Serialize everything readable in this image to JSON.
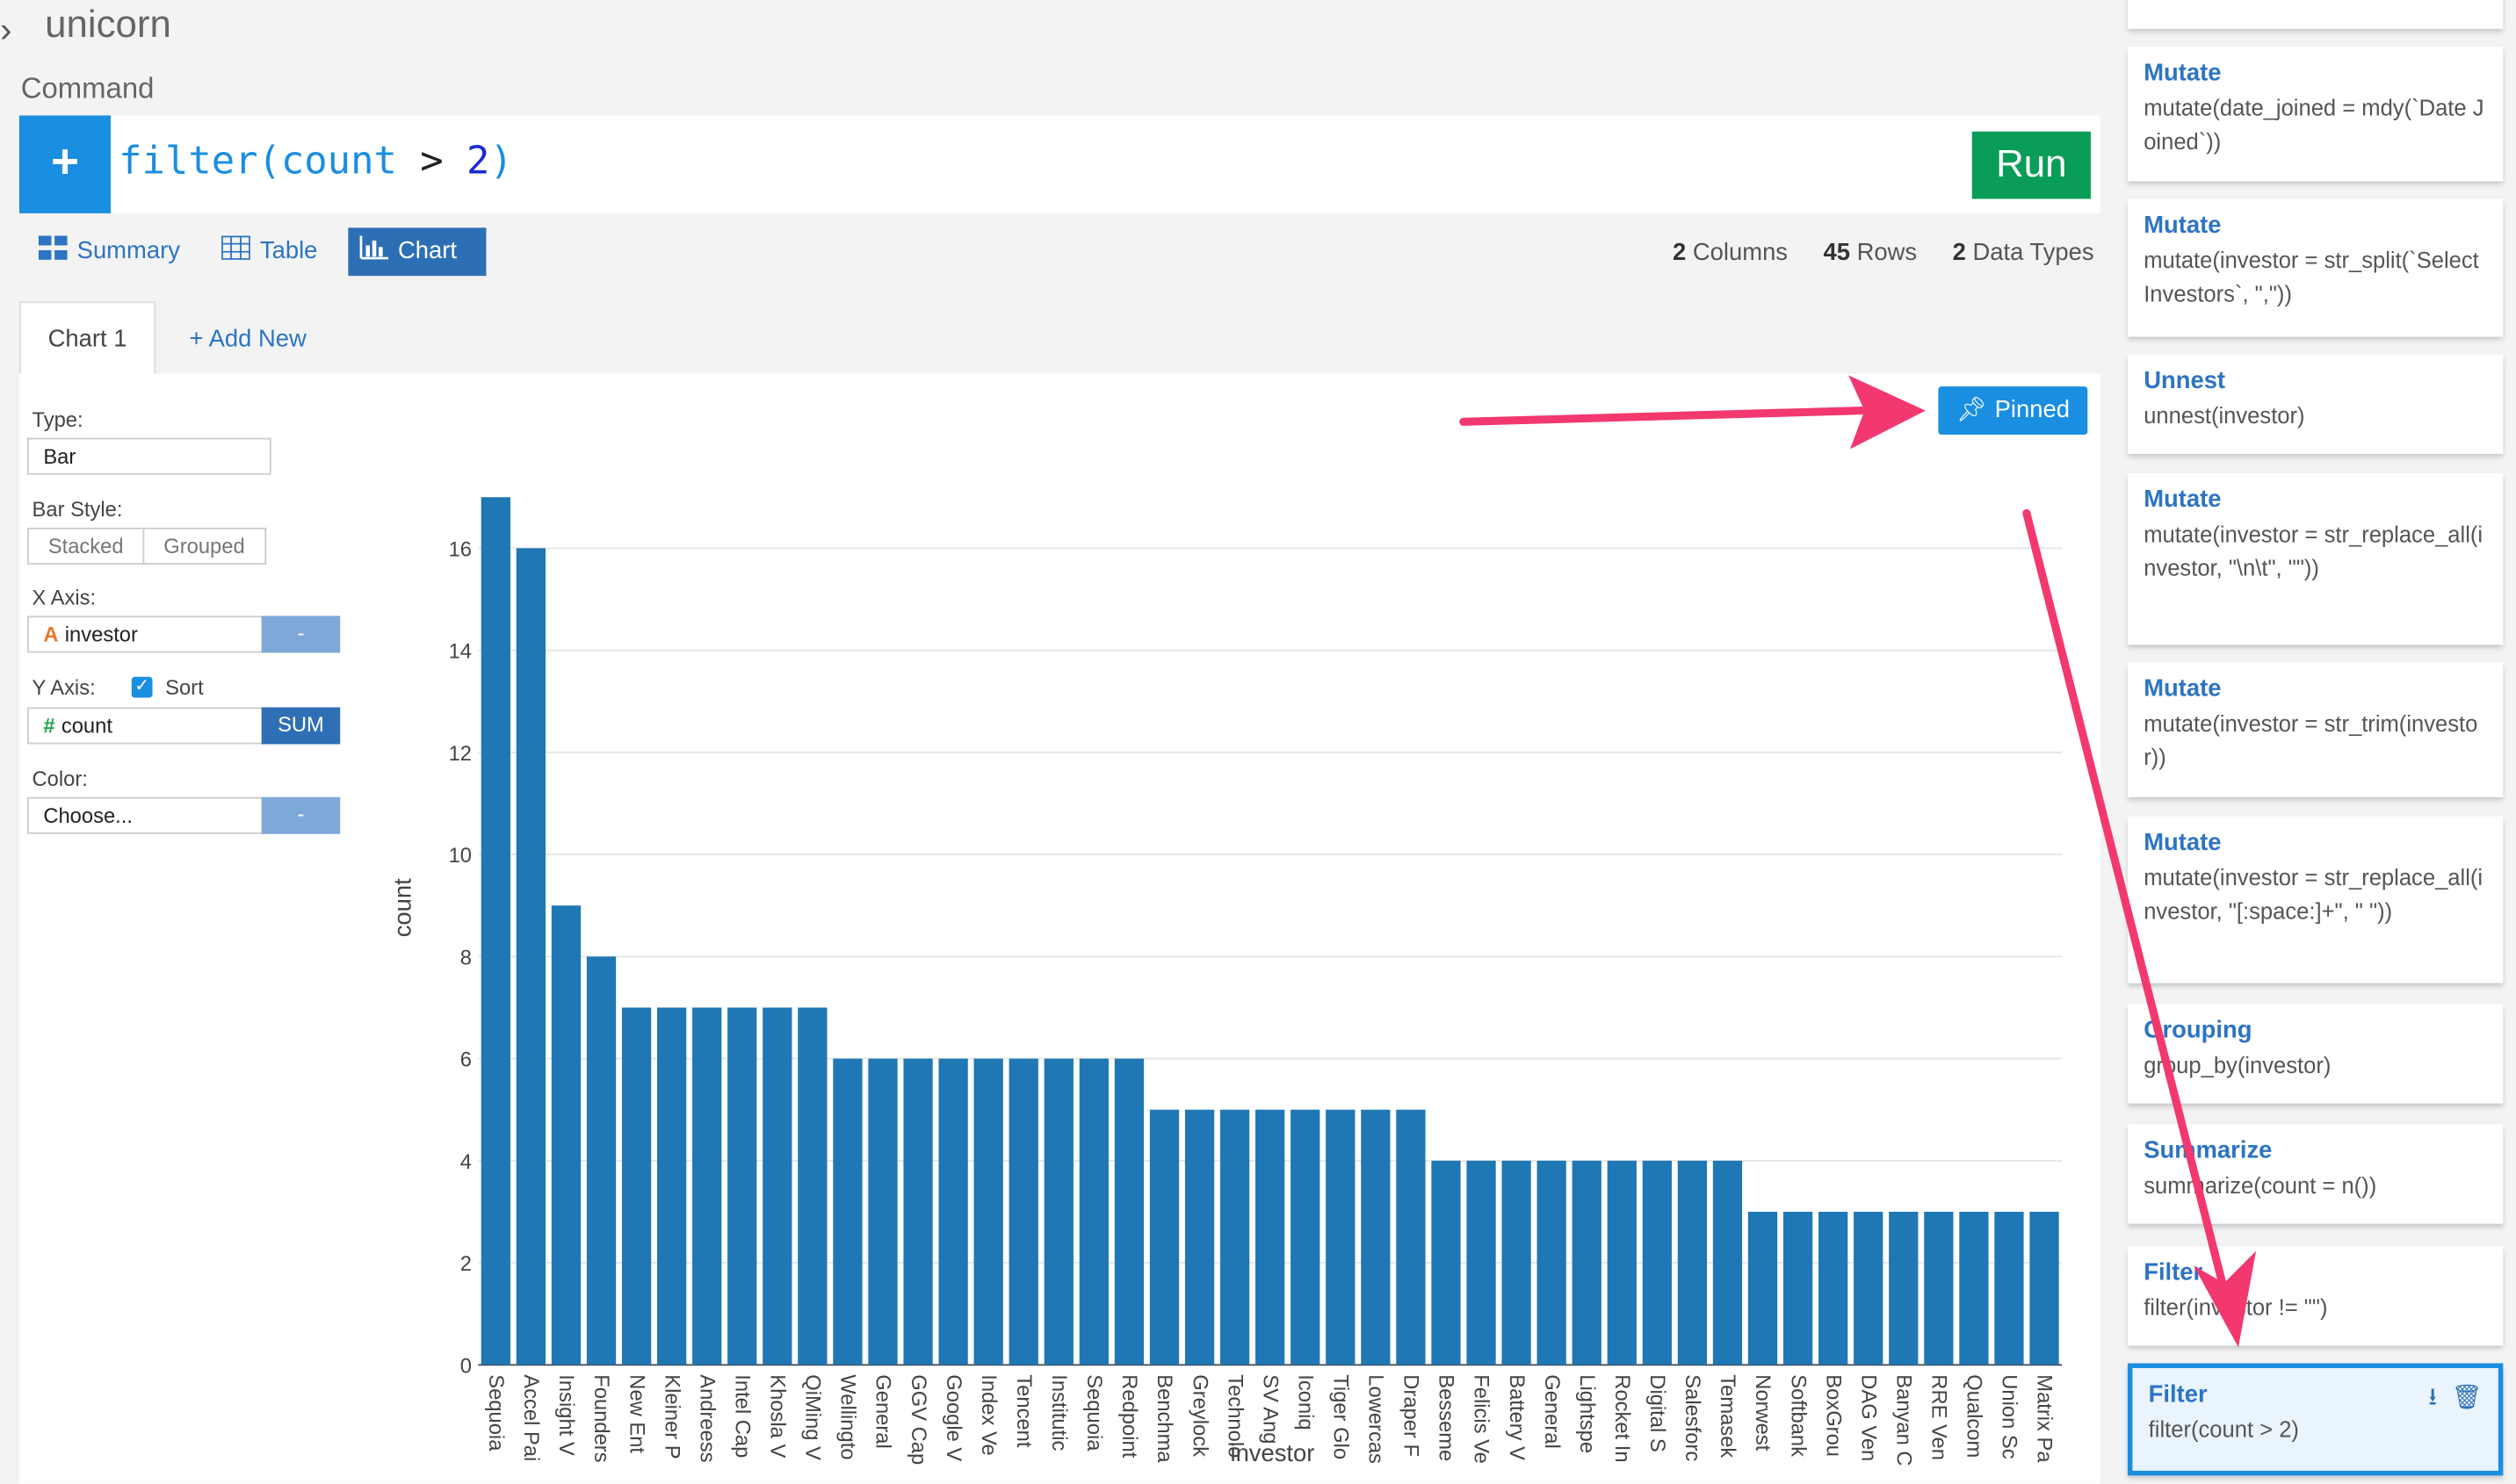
{
  "app": {
    "title": "unicorn"
  },
  "command": {
    "label": "Command",
    "plus": "+",
    "func": "filter(count",
    "op": " > ",
    "num": "2",
    "close": ")",
    "run_label": "Run"
  },
  "view_tabs": [
    {
      "label": "Summary",
      "icon": "grid-icon"
    },
    {
      "label": "Table",
      "icon": "table-icon"
    },
    {
      "label": "Chart",
      "icon": "bar-chart-icon",
      "active": true
    }
  ],
  "stats": {
    "columns_num": "2",
    "columns_label": "Columns",
    "rows_num": "45",
    "rows_label": "Rows",
    "types_num": "2",
    "types_label": "Data Types"
  },
  "chart_tabs": {
    "active": "Chart 1",
    "add_new": "+ Add New"
  },
  "controls": {
    "type_label": "Type:",
    "type_value": "Bar",
    "bar_style_label": "Bar Style:",
    "bar_style_options": [
      "Stacked",
      "Grouped"
    ],
    "x_axis_label": "X Axis:",
    "x_axis_value": "investor",
    "x_axis_type_icon": "A",
    "x_axis_btn": "-",
    "y_axis_label": "Y Axis:",
    "sort_label": "Sort",
    "sort_checked": true,
    "y_axis_value": "count",
    "y_axis_type_icon": "#",
    "y_agg_btn": "SUM",
    "color_label": "Color:",
    "color_value": "Choose...",
    "color_btn": "-",
    "pinned_label": "Pinned"
  },
  "colors": {
    "accent": "#1a8ee1",
    "bar": "#1f77b4",
    "run": "#0a9d58",
    "arrow": "#f2386f"
  },
  "chart_data": {
    "type": "bar",
    "xlabel": "investor",
    "ylabel": "count",
    "ylim": [
      0,
      17
    ],
    "yticks": [
      0,
      2,
      4,
      6,
      8,
      10,
      12,
      14,
      16
    ],
    "grid": true,
    "categories": [
      "Sequoia",
      "Accel Pai",
      "Insight V",
      "Founders",
      "New Ent",
      "Kleiner P",
      "Andreess",
      "Intel Cap",
      "Khosla V",
      "QiMing V",
      "Wellingto",
      "General",
      "GGV Cap",
      "Google V",
      "Index Ve",
      "Tencent",
      "Institutic",
      "Sequoia",
      "Redpoint",
      "Benchma",
      "Greylock",
      "Technolo",
      "SV Ang",
      "Iconiq",
      "Tiger Glo",
      "Lowercas",
      "Draper F",
      "Besseme",
      "Felicis Ve",
      "Battery V",
      "General",
      "Lightspe",
      "Rocket In",
      "Digital S",
      "Salesforc",
      "Temasek",
      "Norwest",
      "Softbank",
      "BoxGrou",
      "DAG Ven",
      "Banyan C",
      "RRE Ven",
      "Qualcom",
      "Union Sc",
      "Matrix Pa"
    ],
    "values": [
      17,
      16,
      9,
      8,
      7,
      7,
      7,
      7,
      7,
      7,
      6,
      6,
      6,
      6,
      6,
      6,
      6,
      6,
      6,
      5,
      5,
      5,
      5,
      5,
      5,
      5,
      5,
      4,
      4,
      4,
      4,
      4,
      4,
      4,
      4,
      4,
      3,
      3,
      3,
      3,
      3,
      3,
      3,
      3,
      3
    ]
  },
  "steps": [
    {
      "title": "",
      "code": ""
    },
    {
      "title": "Mutate",
      "code": "mutate(date_joined = mdy(`Date Joined`))"
    },
    {
      "title": "Mutate",
      "code": "mutate(investor = str_split(`Select Investors`, \",\"))"
    },
    {
      "title": "Unnest",
      "code": "unnest(investor)"
    },
    {
      "title": "Mutate",
      "code": "mutate(investor = str_replace_all(investor, \"\\n\\t\", \"\"))"
    },
    {
      "title": "Mutate",
      "code": "mutate(investor = str_trim(investor))"
    },
    {
      "title": "Mutate",
      "code": "mutate(investor = str_replace_all(investor, \"[:space:]+\", \" \"))"
    },
    {
      "title": "Grouping",
      "code": "group_by(investor)"
    },
    {
      "title": "Summarize",
      "code": "summarize(count = n())"
    },
    {
      "title": "Filter",
      "code": "filter(investor != \"\")"
    },
    {
      "title": "Filter",
      "code": "filter(count > 2)",
      "active": true
    }
  ]
}
